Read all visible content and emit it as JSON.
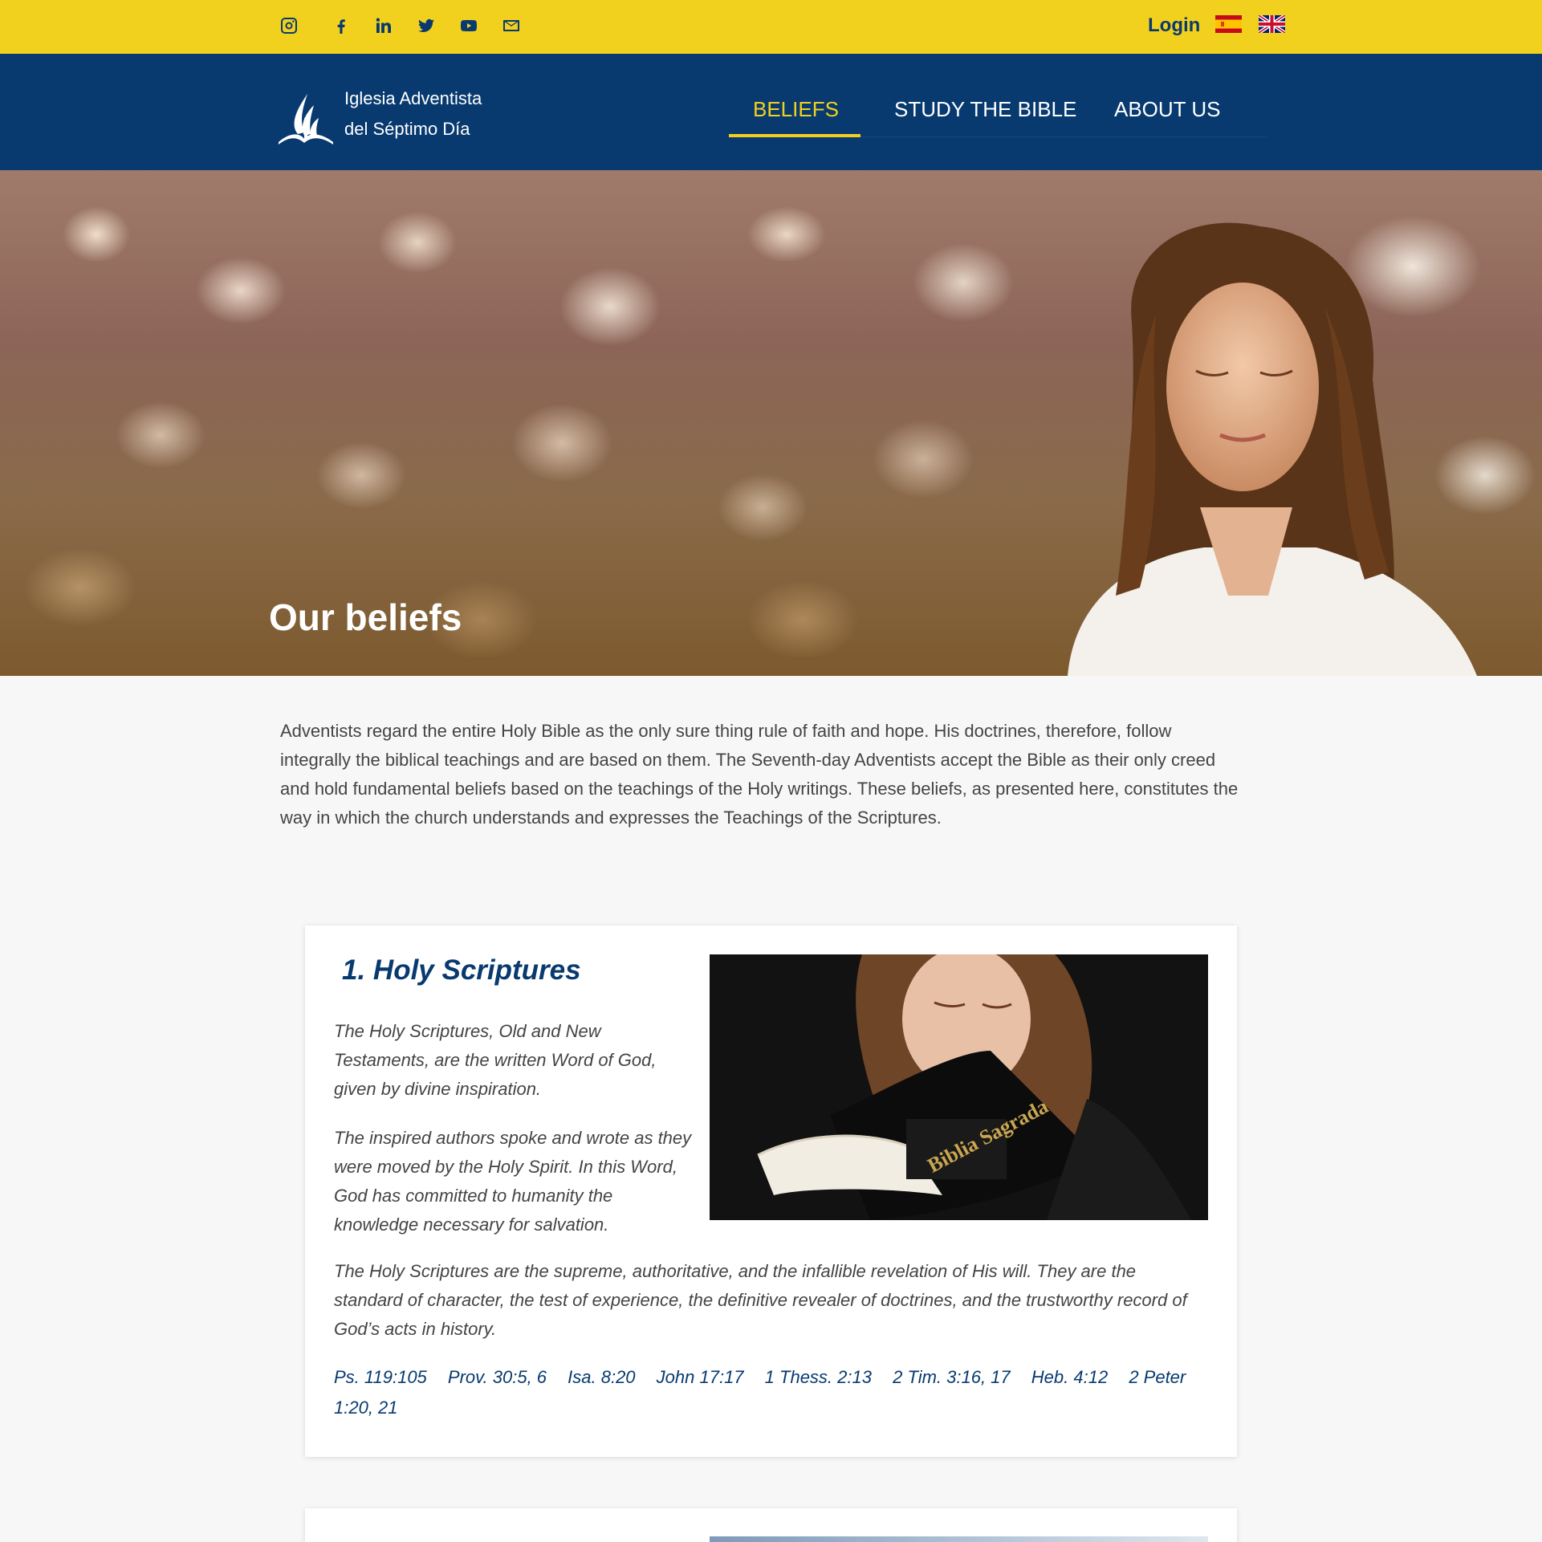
{
  "topbar": {
    "social": [
      {
        "name": "instagram-icon"
      },
      {
        "name": "facebook-icon"
      },
      {
        "name": "linkedin-icon"
      },
      {
        "name": "twitter-icon"
      },
      {
        "name": "youtube-icon"
      },
      {
        "name": "envelope-icon"
      }
    ],
    "login_label": "Login",
    "languages": [
      "Español",
      "English"
    ]
  },
  "brand": {
    "line1": "Iglesia Adventista",
    "line2": "del Séptimo Día"
  },
  "nav": {
    "items": [
      {
        "label": "BELIEFS",
        "active": true
      },
      {
        "label": "STUDY THE BIBLE",
        "active": false
      },
      {
        "label": "ABOUT US",
        "active": false
      }
    ]
  },
  "hero": {
    "title": "Our beliefs"
  },
  "intro": {
    "text": "Adventists regard the entire Holy Bible as the only sure thing rule of faith and hope. His doctrines, therefore, follow integrally the biblical teachings and are based on them. The Seventh-day Adventists accept the Bible as their only creed and hold fundamental beliefs based on the teachings of the Holy writings. These beliefs, as presented here, constitutes the way in which the church understands and expresses the Teachings of the Scriptures."
  },
  "beliefs": [
    {
      "title": "1. Holy Scriptures",
      "image_text": "Biblia Sagrada",
      "paragraphs": [
        "The Holy Scriptures, Old and New Testaments, are the written Word of God, given by divine inspiration.",
        "The inspired authors spoke and wrote as they were moved by the Holy Spirit. In this Word, God has committed to humanity the knowledge necessary for salvation.",
        "The Holy Scriptures are the supreme, authoritative, and the infallible revelation of His will. They are the standard of character, the test of experience, the definitive revealer of doctrines, and the trustworthy record of God’s acts in history."
      ],
      "references": [
        "Ps. 119:105",
        "Prov. 30:5, 6",
        "Isa. 8:20",
        "John 17:17",
        "1 Thess. 2:13",
        "2 Tim. 3:16, 17",
        "Heb. 4:12",
        "2 Peter 1:20, 21"
      ]
    }
  ],
  "colors": {
    "topbar": "#f2d11e",
    "navbar": "#083a6f",
    "accent": "#f2d11e",
    "heading": "#083a6f"
  }
}
